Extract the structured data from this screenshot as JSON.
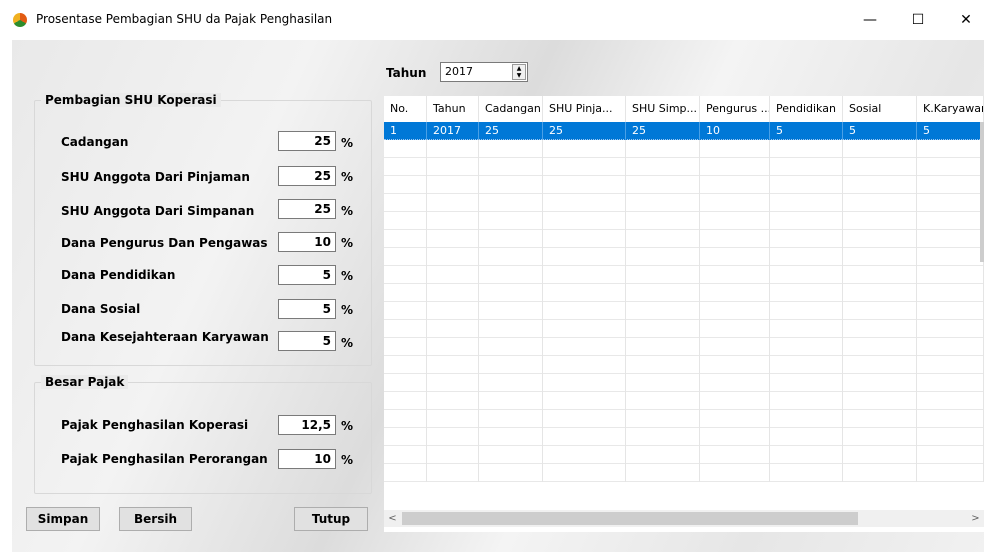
{
  "window": {
    "title": "Prosentase Pembagian SHU da Pajak Penghasilan",
    "minimize": "—",
    "maximize": "☐",
    "close": "✕"
  },
  "shu_group": {
    "title": "Pembagian SHU Koperasi",
    "fields": [
      {
        "label": "Cadangan",
        "value": "25",
        "unit": "%"
      },
      {
        "label": "SHU Anggota Dari Pinjaman",
        "value": "25",
        "unit": "%"
      },
      {
        "label": "SHU Anggota Dari Simpanan",
        "value": "25",
        "unit": "%"
      },
      {
        "label": "Dana Pengurus Dan Pengawas",
        "value": "10",
        "unit": "%"
      },
      {
        "label": "Dana Pendidikan",
        "value": "5",
        "unit": "%"
      },
      {
        "label": "Dana Sosial",
        "value": "5",
        "unit": "%"
      },
      {
        "label": "Dana Kesejahteraan Karyawan",
        "value": "5",
        "unit": "%"
      }
    ]
  },
  "tax_group": {
    "title": "Besar Pajak",
    "fields": [
      {
        "label": "Pajak Penghasilan Koperasi",
        "value": "12,5",
        "unit": "%"
      },
      {
        "label": "Pajak Penghasilan Perorangan",
        "value": "10",
        "unit": "%"
      }
    ]
  },
  "buttons": {
    "save": "Simpan",
    "clear": "Bersih",
    "close": "Tutup"
  },
  "year_filter": {
    "label": "Tahun",
    "value": "2017",
    "spin_up": "▲",
    "spin_down": "▼"
  },
  "table": {
    "columns": [
      "No.",
      "Tahun",
      "Cadangan",
      "SHU Pinja...",
      "SHU Simp...",
      "Pengurus ...",
      "Pendidikan",
      "Sosial",
      "K.Karyawan"
    ],
    "rows": [
      [
        "1",
        "2017",
        "25",
        "25",
        "25",
        "10",
        "5",
        "5",
        "5"
      ]
    ],
    "selected_row": 0
  },
  "scrollbar": {
    "left_arrow": "<",
    "right_arrow": ">"
  }
}
